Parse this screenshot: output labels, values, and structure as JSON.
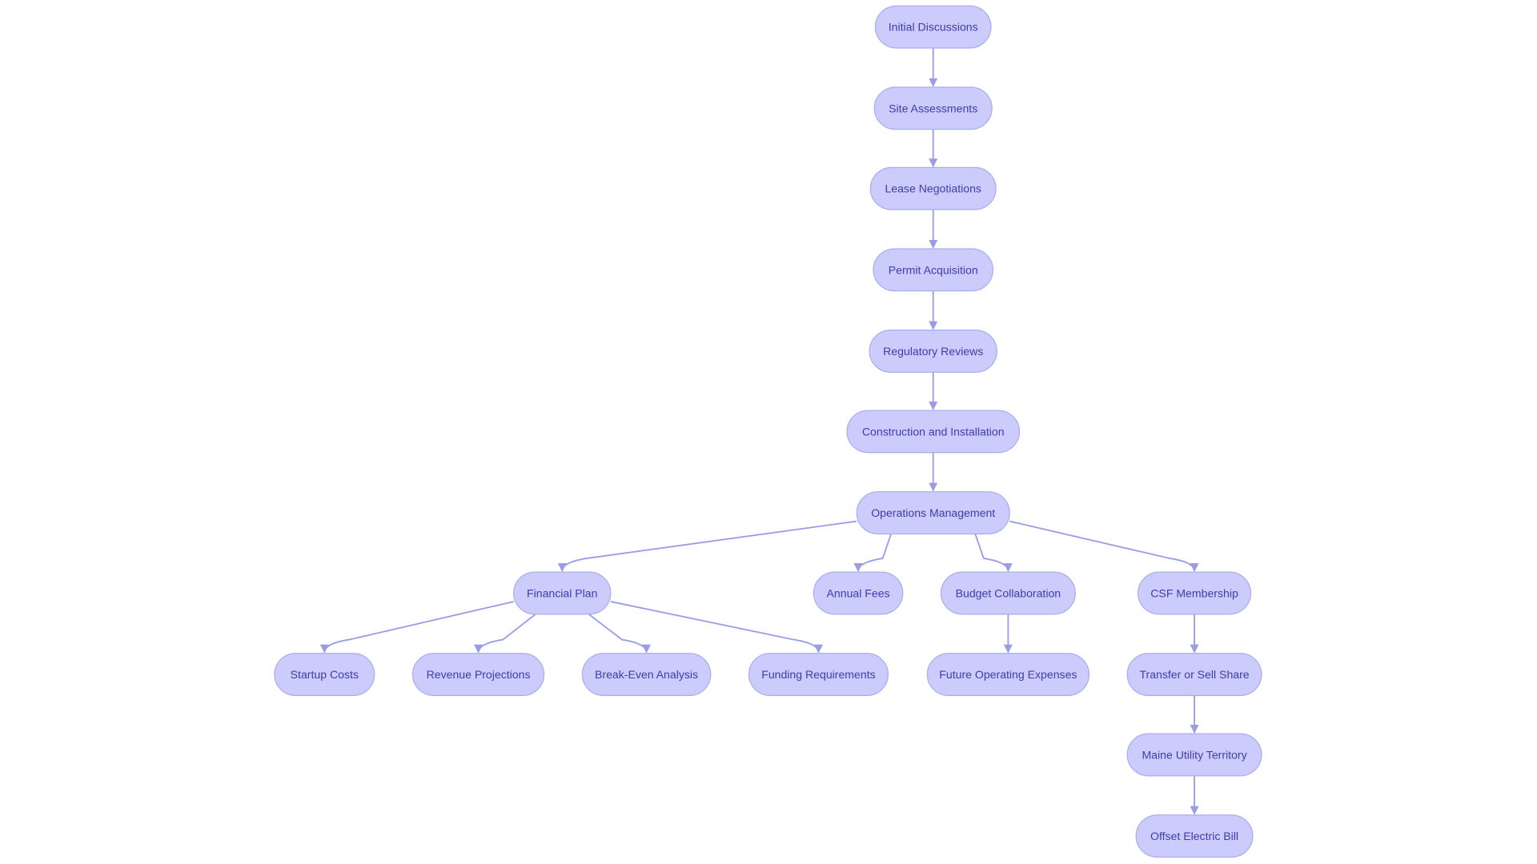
{
  "diagram": {
    "type": "flowchart",
    "direction": "top-down",
    "colors": {
      "node_fill": "#cbccfb",
      "node_stroke": "#a9acf0",
      "text": "#3d3cb0",
      "edge": "#9a9de6"
    },
    "nodes": [
      {
        "id": "initial",
        "label": "Initial Discussions"
      },
      {
        "id": "site",
        "label": "Site Assessments"
      },
      {
        "id": "lease",
        "label": "Lease Negotiations"
      },
      {
        "id": "permit",
        "label": "Permit Acquisition"
      },
      {
        "id": "regulatory",
        "label": "Regulatory Reviews"
      },
      {
        "id": "construction",
        "label": "Construction and Installation"
      },
      {
        "id": "operations",
        "label": "Operations Management"
      },
      {
        "id": "financial",
        "label": "Financial Plan"
      },
      {
        "id": "annual",
        "label": "Annual Fees"
      },
      {
        "id": "budget",
        "label": "Budget Collaboration"
      },
      {
        "id": "csf",
        "label": "CSF Membership"
      },
      {
        "id": "startup",
        "label": "Startup Costs"
      },
      {
        "id": "revenue",
        "label": "Revenue Projections"
      },
      {
        "id": "breakeven",
        "label": "Break-Even Analysis"
      },
      {
        "id": "funding",
        "label": "Funding Requirements"
      },
      {
        "id": "future",
        "label": "Future Operating Expenses"
      },
      {
        "id": "transfer",
        "label": "Transfer or Sell Share"
      },
      {
        "id": "maine",
        "label": "Maine Utility Territory"
      },
      {
        "id": "offset",
        "label": "Offset Electric Bill"
      }
    ],
    "edges": [
      {
        "from": "initial",
        "to": "site"
      },
      {
        "from": "site",
        "to": "lease"
      },
      {
        "from": "lease",
        "to": "permit"
      },
      {
        "from": "permit",
        "to": "regulatory"
      },
      {
        "from": "regulatory",
        "to": "construction"
      },
      {
        "from": "construction",
        "to": "operations"
      },
      {
        "from": "operations",
        "to": "financial"
      },
      {
        "from": "operations",
        "to": "annual"
      },
      {
        "from": "operations",
        "to": "budget"
      },
      {
        "from": "operations",
        "to": "csf"
      },
      {
        "from": "financial",
        "to": "startup"
      },
      {
        "from": "financial",
        "to": "revenue"
      },
      {
        "from": "financial",
        "to": "breakeven"
      },
      {
        "from": "financial",
        "to": "funding"
      },
      {
        "from": "budget",
        "to": "future"
      },
      {
        "from": "csf",
        "to": "transfer"
      },
      {
        "from": "transfer",
        "to": "maine"
      },
      {
        "from": "maine",
        "to": "offset"
      }
    ]
  }
}
